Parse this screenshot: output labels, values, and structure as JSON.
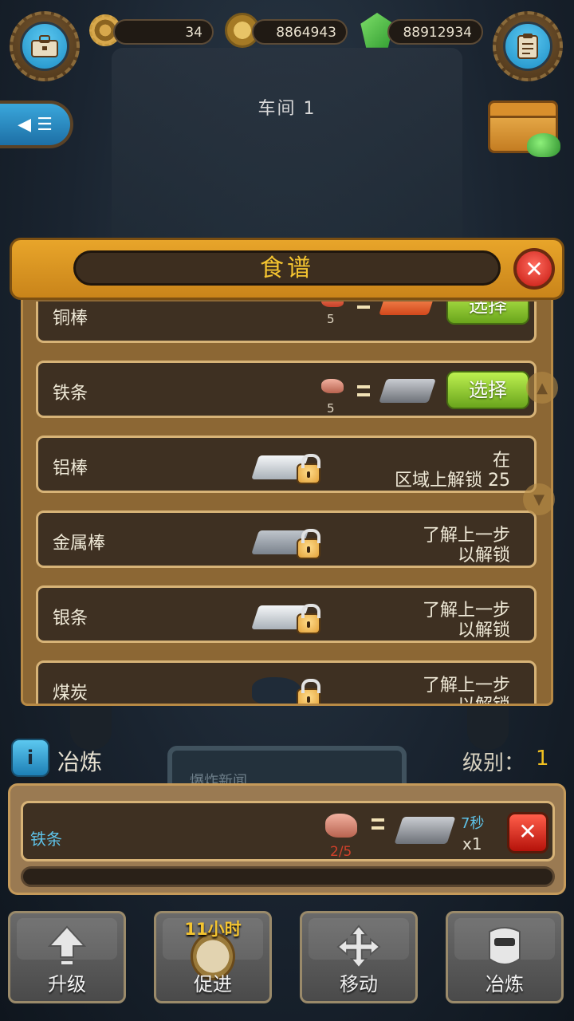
{
  "hud": {
    "gears": "34",
    "coins": "8864943",
    "gems": "88912934"
  },
  "workshop": {
    "title": "车间  1"
  },
  "recipe_panel": {
    "title": "食谱",
    "select_label": "选择",
    "items": [
      {
        "name": "铜棒",
        "ore_qty": "5"
      },
      {
        "name": "铁条",
        "ore_qty": "5"
      },
      {
        "name": "铝棒",
        "unlock_line1": "在",
        "unlock_line2": "区域上解锁  25"
      },
      {
        "name": "金属棒",
        "unlock_line1": "了解上一步",
        "unlock_line2": "以解锁"
      },
      {
        "name": "银条",
        "unlock_line1": "了解上一步",
        "unlock_line2": "以解锁"
      },
      {
        "name": "煤炭",
        "unlock_line1": "了解上一步",
        "unlock_line2": "以解锁"
      }
    ]
  },
  "background": {
    "news_screen": "爆炸新闻"
  },
  "smelting": {
    "label": "冶炼",
    "level_label": "级别：",
    "level_value": "1",
    "job": {
      "name": "铁条",
      "progress": "2/5",
      "time": "7秒",
      "quantity": "x1"
    }
  },
  "toolbar": {
    "upgrade": "升级",
    "boost": "促进",
    "boost_timer": "11小时",
    "move": "移动",
    "smelt": "冶炼"
  },
  "icons": {
    "briefcase": "briefcase-icon",
    "clipboard": "clipboard-icon",
    "menu": "menu-icon",
    "chest": "chest-icon"
  },
  "colors": {
    "accent_gold": "#f4c430",
    "select_green": "#8cc63f",
    "cancel_red": "#d0241a",
    "info_blue": "#2a9fd8"
  }
}
